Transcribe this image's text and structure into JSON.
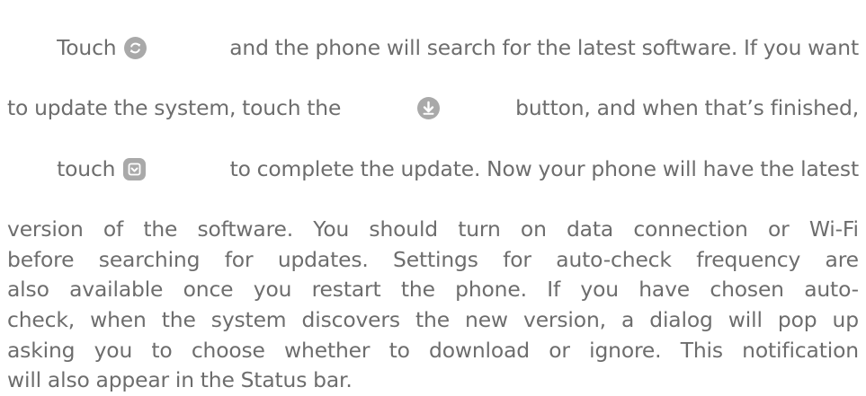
{
  "paragraph": {
    "l1_a": "Touch ",
    "l1_b": " and the phone will search for the latest software. If you want",
    "l2_a": "to update the system, touch the ",
    "l2_b": " button, and when that’s finished,",
    "l3_a": "touch ",
    "l3_b": " to complete the update. Now your phone will have the latest",
    "l4": "version of the software. You should turn on data connection or Wi-Fi",
    "l5": "before searching for updates. Settings for auto-check frequency are",
    "l6": "also available once you restart the phone. If you have chosen auto-",
    "l7": "check, when the system discovers the new version, a dialog will pop up",
    "l8": "asking you to choose whether to download or ignore. This notification",
    "l9": "will also appear in the Status bar."
  },
  "icons": {
    "refresh": "refresh-icon",
    "download": "download-icon",
    "install": "install-update-icon",
    "color": "#a9a9a9"
  }
}
